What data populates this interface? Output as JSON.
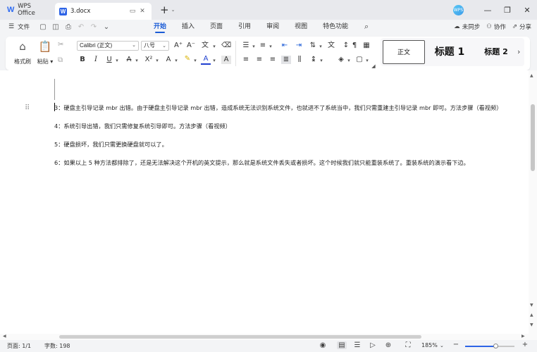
{
  "titlebar": {
    "app_tab": "WPS Office",
    "doc_tab": "3.docx",
    "doc_icon_letter": "W",
    "avatar_text": "WPS",
    "icons": [
      "monitor-icon",
      "close-icon",
      "plus-icon",
      "minimize-icon",
      "restore-icon",
      "close-window-icon"
    ]
  },
  "menubar": {
    "file": "文件",
    "tabs": [
      "开始",
      "插入",
      "页面",
      "引用",
      "审阅",
      "视图",
      "特色功能"
    ],
    "active_tab": "开始",
    "sync": "未同步",
    "collab": "协作",
    "share": "分享"
  },
  "ribbon": {
    "format_painter": "格式刷",
    "paste": "粘贴",
    "font_name": "Calibri (正文)",
    "font_size": "八号",
    "styles": {
      "normal": "正文",
      "heading1": "标题 1",
      "heading2": "标题 2"
    }
  },
  "document": {
    "paragraphs": [
      "3：硬盘主引导记录 mbr 出错。由于硬盘主引导记录 mbr 出错，造成系统无法识别系统文件，也就进不了系统当中，我们只需重建主引导记录 mbr 即可。方法步骤（看视频）",
      "4：系统引导出错，我们只需修复系统引导即可。方法步骤（看视频）",
      "5：硬盘损坏，我们只需更换硬盘就可以了。",
      "6：如果以上 5 种方法都排除了，还是无法解决这个开机的英文提示，那么就是系统文件丢失或者损坏。这个时候我们就只能重装系统了。重装系统的演示看下边。"
    ]
  },
  "statusbar": {
    "page": "页面: 1/1",
    "words": "字数: 198",
    "zoom": "185%",
    "zoom_level": 0.62
  },
  "colors": {
    "accent": "#1a5bd6",
    "title_bg": "#e8e9ed",
    "ribbon_bg": "#f3f4f6"
  }
}
